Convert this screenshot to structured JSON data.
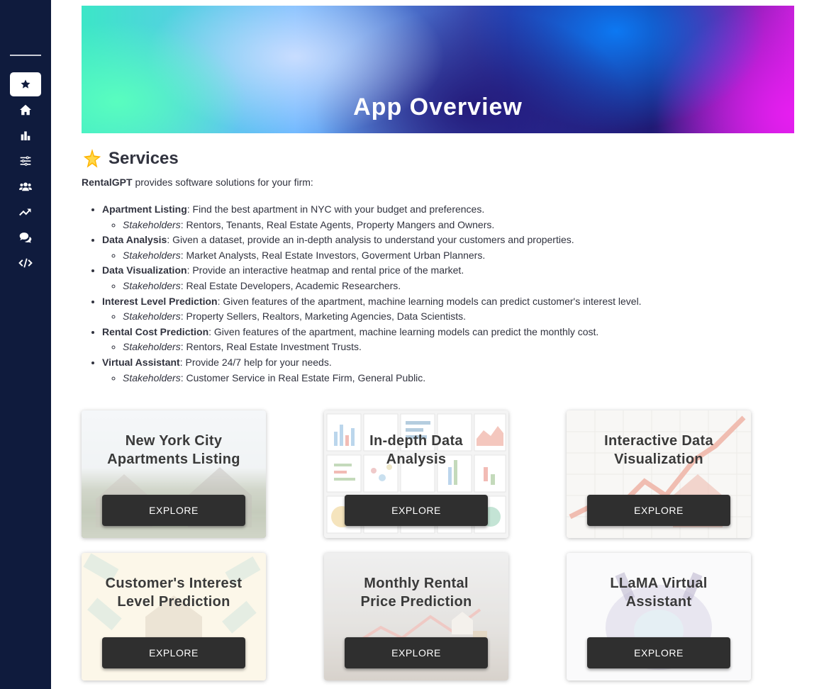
{
  "sidebar": {
    "items": [
      {
        "icon": "star-icon",
        "active": true
      },
      {
        "icon": "home-icon",
        "active": false
      },
      {
        "icon": "bar-chart-icon",
        "active": false
      },
      {
        "icon": "sliders-icon",
        "active": false
      },
      {
        "icon": "users-icon",
        "active": false
      },
      {
        "icon": "trend-up-icon",
        "active": false
      },
      {
        "icon": "comments-icon",
        "active": false
      },
      {
        "icon": "code-icon",
        "active": false
      }
    ]
  },
  "hero": {
    "title": "App Overview"
  },
  "services": {
    "heading": "Services",
    "intro_brand": "RentalGPT",
    "intro_text": " provides software solutions for your firm:",
    "stakeholders_label": "Stakeholders",
    "items": [
      {
        "name": "Apartment Listing",
        "desc": ": Find the best apartment in NYC with your budget and preferences.",
        "stakeholders": ": Rentors, Tenants, Real Estate Agents, Property Mangers and Owners."
      },
      {
        "name": "Data Analysis",
        "desc": ": Given a dataset, provide an in-depth analysis to understand your customers and properties.",
        "stakeholders": ": Market Analysts, Real Estate Investors, Goverment Urban Planners."
      },
      {
        "name": "Data Visualization",
        "desc": ": Provide an interactive heatmap and rental price of the market.",
        "stakeholders": ": Real Estate Developers, Academic Researchers."
      },
      {
        "name": "Interest Level Prediction",
        "desc": ": Given features of the apartment, machine learning models can predict customer's interest level.",
        "stakeholders": ": Property Sellers, Realtors, Marketing Agencies, Data Scientists."
      },
      {
        "name": "Rental Cost Prediction",
        "desc": ": Given features of the apartment, machine learning models can predict the monthly cost.",
        "stakeholders": ": Rentors, Real Estate Investment Trusts."
      },
      {
        "name": "Virtual Assistant",
        "desc": ": Provide 24/7 help for your needs.",
        "stakeholders": ": Customer Service in Real Estate Firm, General Public."
      }
    ]
  },
  "cards": [
    {
      "title_line1": "New York City",
      "title_line2": "Apartments Listing",
      "button": "EXPLORE"
    },
    {
      "title_line1": "In-depth Data",
      "title_line2": "Analysis",
      "button": "EXPLORE"
    },
    {
      "title_line1": "Interactive Data",
      "title_line2": "Visualization",
      "button": "EXPLORE"
    },
    {
      "title_line1": "Customer's Interest",
      "title_line2": "Level Prediction",
      "button": "EXPLORE"
    },
    {
      "title_line1": "Monthly Rental",
      "title_line2": "Price Prediction",
      "button": "EXPLORE"
    },
    {
      "title_line1": "LLaMA Virtual",
      "title_line2": "Assistant",
      "button": "EXPLORE"
    }
  ]
}
